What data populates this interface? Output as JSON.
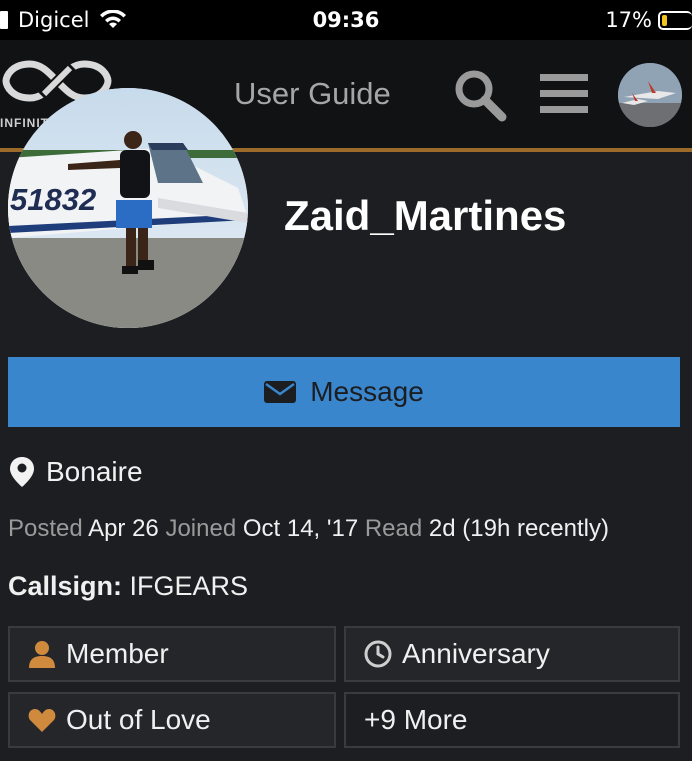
{
  "status_bar": {
    "carrier": "Digicel",
    "time": "09:36",
    "battery": "17%"
  },
  "header": {
    "logo_text": "INFINITE",
    "title": "User Guide"
  },
  "profile": {
    "username": "Zaid_Martines",
    "photo_tail_number": "51832",
    "message_label": "Message",
    "location": "Bonaire",
    "stats": {
      "posted_label": "Posted",
      "posted_value": "Apr 26",
      "joined_label": "Joined",
      "joined_value": "Oct 14, '17",
      "read_label": "Read",
      "read_value": "2d (19h recently)"
    },
    "callsign_label": "Callsign:",
    "callsign_value": "IFGEARS"
  },
  "badges": [
    {
      "label": "Member",
      "icon": "person-icon",
      "color": "#d08a3e"
    },
    {
      "label": "Anniversary",
      "icon": "clock-icon",
      "color": "#cfcfcf"
    },
    {
      "label": "Out of Love",
      "icon": "heart-icon",
      "color": "#d08a3e"
    },
    {
      "label": "+9 More",
      "icon": "",
      "color": ""
    }
  ],
  "colors": {
    "accent_blue": "#3a86cc",
    "accent_gold": "#9c6b2c",
    "background": "#1d1e21"
  }
}
